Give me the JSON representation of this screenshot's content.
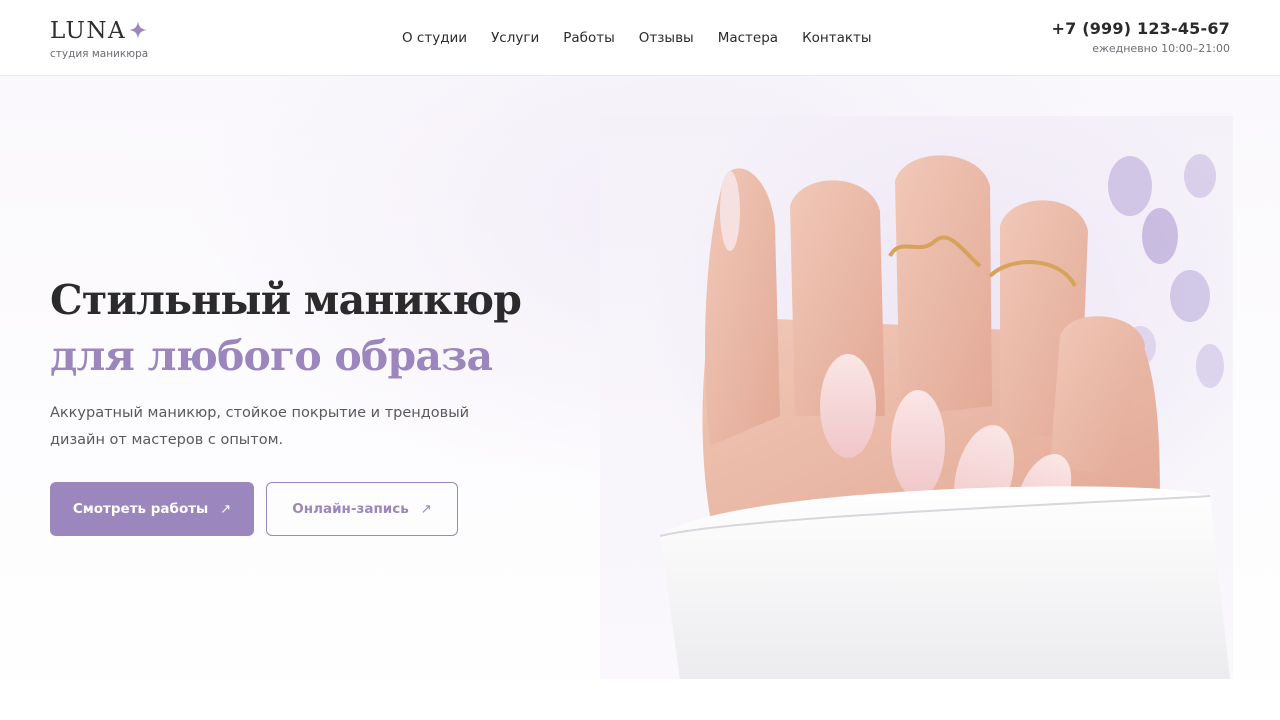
{
  "brand": {
    "name": "LUNA",
    "tagline": "студия маникюра",
    "accent_color": "#9b86bd",
    "star_icon": "sparkle-star-icon"
  },
  "nav": {
    "items": [
      {
        "label": "О студии"
      },
      {
        "label": "Услуги"
      },
      {
        "label": "Работы"
      },
      {
        "label": "Отзывы"
      },
      {
        "label": "Мастера"
      },
      {
        "label": "Контакты"
      }
    ]
  },
  "contact": {
    "phone": "+7 (999) 123-45-67",
    "hours": "ежедневно 10:00–21:00"
  },
  "hero": {
    "title_main": "Стильный маникюр ",
    "title_accent": "для любого образа",
    "subtitle": "Аккуратный маникюр, стойкое покрытие и трендовый дизайн от мастеров с опытом.",
    "primary_button": "Смотреть работы",
    "secondary_button": "Онлайн-запись",
    "button_arrow_icon": "arrow-up-right-icon",
    "photo_subject": "manicured-hand-photo"
  }
}
